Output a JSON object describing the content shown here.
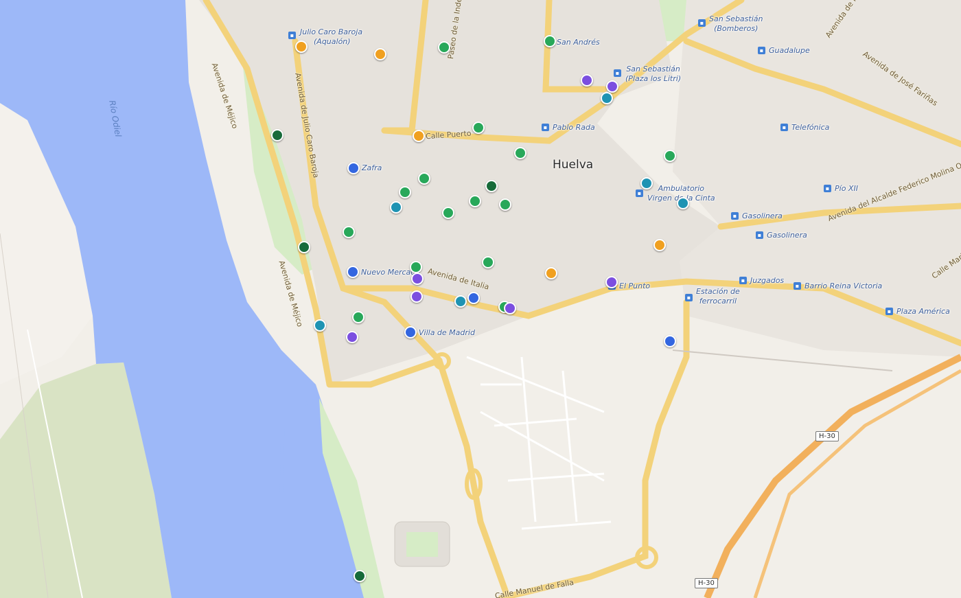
{
  "map": {
    "city_label": "Huelva",
    "river_label": "Río Odiel",
    "place_labels": [
      {
        "text": "Julio Caro Baroja",
        "sub": "(Aqualón)"
      },
      {
        "text": "San Andrés"
      },
      {
        "text": "San Sebastián",
        "sub": "(Bomberos)"
      },
      {
        "text": "San Sebastián",
        "sub": "(Plaza los Litri)"
      },
      {
        "text": "Guadalupe"
      },
      {
        "text": "Pablo Rada"
      },
      {
        "text": "Telefónica"
      },
      {
        "text": "Zafra"
      },
      {
        "text": "Ambulatorio",
        "sub": "Virgen de la Cinta"
      },
      {
        "text": "Pío XII"
      },
      {
        "text": "Gasolinera"
      },
      {
        "text": "Gasolinera"
      },
      {
        "text": "Nuevo Mercado"
      },
      {
        "text": "El Punto"
      },
      {
        "text": "Juzgados"
      },
      {
        "text": "Barrio Reina Victoria"
      },
      {
        "text": "Estación de",
        "sub": "ferrocarril"
      },
      {
        "text": "Plaza América"
      },
      {
        "text": "Villa de Madrid"
      }
    ],
    "street_labels": [
      "Calle Puerto",
      "Avenida de Méjico",
      "Avenida de Julio Caro Baroja",
      "Avenida de Méjico",
      "Avenida de Italia",
      "Avenida de José Fariñas",
      "Avenida del Alcalde Federico Molina Orta",
      "Calle Manuel de Falla",
      "Paseo de la Independencia",
      "Avenida de Portugal",
      "Calle Marina"
    ],
    "road_shields": [
      "H-30",
      "H-30"
    ],
    "colors": {
      "water": "#9db8f8",
      "land": "#f2efe9",
      "marsh": "#d9e3c4",
      "park": "#d6ecc6",
      "major_road": "#fbd97a",
      "motorway": "#f5b45c",
      "marker_green": "#28a85a",
      "marker_dark_green": "#176b3a",
      "marker_orange": "#f0a020",
      "marker_purple": "#7b4fe0",
      "marker_blue": "#3366e0",
      "marker_teal": "#1e93b3"
    },
    "markers": [
      {
        "category": "orange"
      },
      {
        "category": "orange"
      },
      {
        "category": "green"
      },
      {
        "category": "green"
      },
      {
        "category": "purple"
      },
      {
        "category": "purple"
      },
      {
        "category": "teal"
      },
      {
        "category": "dark_green"
      },
      {
        "category": "green"
      },
      {
        "category": "orange"
      },
      {
        "category": "green"
      },
      {
        "category": "blue"
      },
      {
        "category": "green"
      },
      {
        "category": "green"
      },
      {
        "category": "dark_green"
      },
      {
        "category": "green"
      },
      {
        "category": "teal"
      },
      {
        "category": "green"
      },
      {
        "category": "green"
      },
      {
        "category": "green"
      },
      {
        "category": "green"
      },
      {
        "category": "teal"
      },
      {
        "category": "teal"
      },
      {
        "category": "dark_green"
      },
      {
        "category": "orange"
      },
      {
        "category": "blue"
      },
      {
        "category": "green"
      },
      {
        "category": "purple"
      },
      {
        "category": "green"
      },
      {
        "category": "orange"
      },
      {
        "category": "purple"
      },
      {
        "category": "purple"
      },
      {
        "category": "teal"
      },
      {
        "category": "blue"
      },
      {
        "category": "green"
      },
      {
        "category": "purple"
      },
      {
        "category": "teal"
      },
      {
        "category": "green"
      },
      {
        "category": "purple"
      },
      {
        "category": "blue"
      },
      {
        "category": "blue"
      },
      {
        "category": "dark_green"
      }
    ]
  }
}
